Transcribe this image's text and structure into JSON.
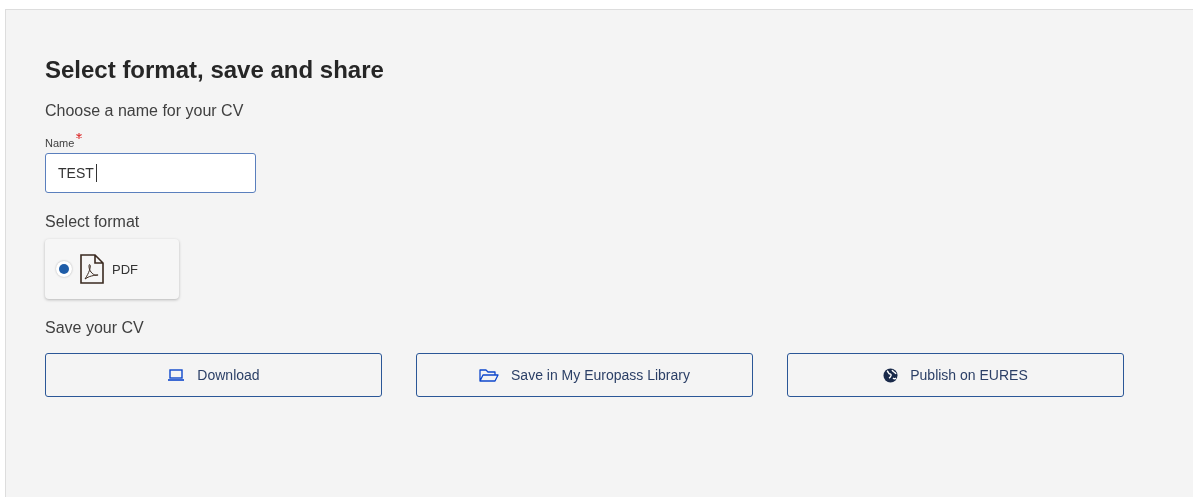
{
  "title": "Select format, save and share",
  "name_section": {
    "heading": "Choose a name for your CV",
    "field": {
      "label": "Name",
      "required": true,
      "value": "TEST"
    }
  },
  "format_section": {
    "heading": "Select format",
    "options": [
      {
        "label": "PDF",
        "selected": true
      }
    ]
  },
  "save_section": {
    "heading": "Save your CV",
    "buttons": [
      {
        "label": "Download",
        "kind": "laptop"
      },
      {
        "label": "Save in My Europass Library",
        "kind": "folder"
      },
      {
        "label": "Publish on EURES",
        "kind": "globe"
      }
    ]
  }
}
